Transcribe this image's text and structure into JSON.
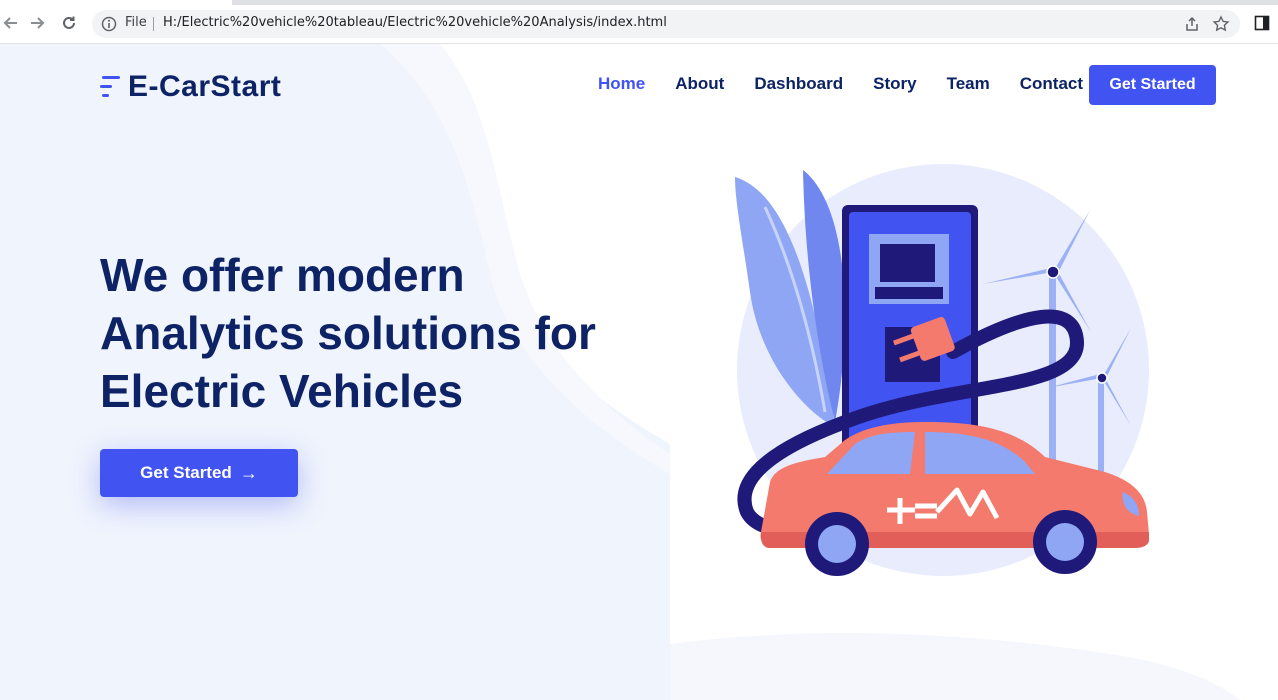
{
  "browser": {
    "scheme_label": "File",
    "url": "H:/Electric%20vehicle%20tableau/Electric%20vehicle%20Analysis/index.html"
  },
  "header": {
    "logo_text": "E-CarStart",
    "nav": [
      {
        "label": "Home",
        "active": true
      },
      {
        "label": "About",
        "active": false
      },
      {
        "label": "Dashboard",
        "active": false
      },
      {
        "label": "Story",
        "active": false
      },
      {
        "label": "Team",
        "active": false
      },
      {
        "label": "Contact",
        "active": false
      }
    ],
    "cta_label": "Get Started"
  },
  "hero": {
    "title_lines": [
      "We offer modern",
      "Analytics solutions for",
      "Electric Vehicles"
    ],
    "cta_label": "Get Started",
    "cta_arrow": "→"
  },
  "colors": {
    "brand_navy": "#0d2366",
    "accent_blue": "#4154f1",
    "background_tint": "#f0f4fd",
    "car_coral": "#f47a6e"
  },
  "icons": {
    "back": "arrow-left-icon",
    "forward": "arrow-right-icon",
    "reload": "reload-icon",
    "info": "info-icon",
    "share": "share-icon",
    "bookmark": "star-icon",
    "side_panel": "side-panel-icon",
    "logo": "menu-lines-logo-icon"
  }
}
